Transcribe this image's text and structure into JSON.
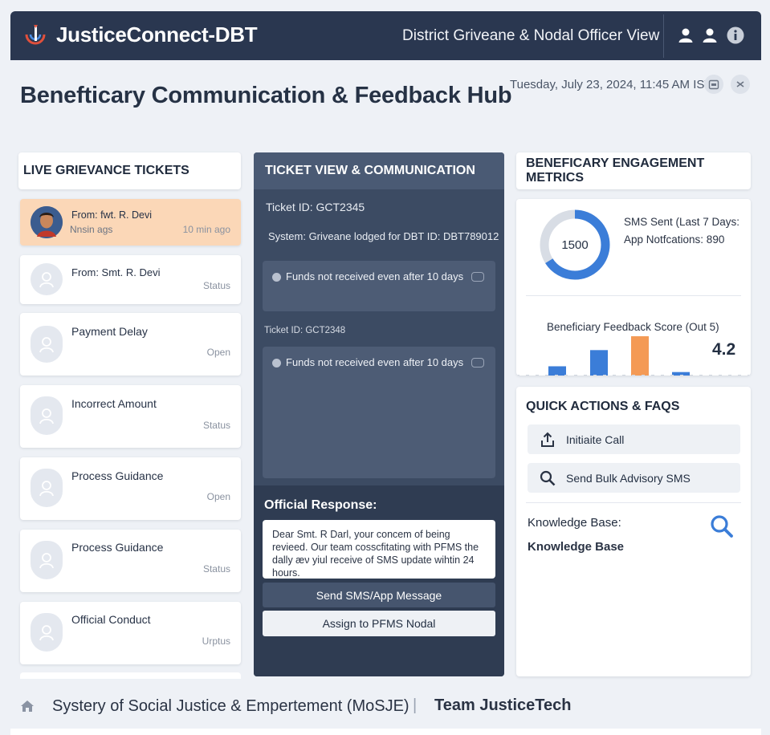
{
  "app": {
    "title": "JusticeConnect-DBT",
    "view": "District Griveane & Nodal Officer View"
  },
  "header": {
    "page_title": "Benefticary Communication & Feedback Hub",
    "datetime": "Tuesday, July 23, 2024, 11:45 AM IST"
  },
  "grievances": {
    "title": "LIVE GRIEVANCE TICKETS",
    "tickets": [
      {
        "title": "From: fwt. R. Devi",
        "sub": "Nnsin ags",
        "status": "10 min ago",
        "active": true
      },
      {
        "title": "From: Smt. R. Devi",
        "status": "Status"
      },
      {
        "title": "Payment Delay",
        "status": "Open"
      },
      {
        "title": "Incorrect Amount",
        "status": "Status"
      },
      {
        "title": "Process Guidance",
        "status": "Open"
      },
      {
        "title": "Process Guidance",
        "status": "Status"
      },
      {
        "title": "Official Conduct",
        "status": "Urptus"
      }
    ]
  },
  "ticket_view": {
    "title": "TICKET VIEW & COMMUNICATION",
    "ticket_id": "Ticket ID: GCT2345",
    "system_msg": "System: Griveane lodged for DBT ID: DBT789012",
    "message_1": "Funds not received even after 10 days",
    "ticket_id_2": "Ticket ID: GCT2348",
    "message_2": "Funds not received even after 10 days",
    "official_label": "Official Response:",
    "response_text": "Dear Smt. R Darl, your concem of being revieed. Our team cosscfitating with PFMS the dally æν yiul receive of SMS update wihtin 24 hours.",
    "send_button": "Send SMS/App Message",
    "assign_button": "Assign to PFMS Nodal"
  },
  "metrics": {
    "title": "BENEFICARY ENGAGEMENT METRICS",
    "donut_value": "1500",
    "donut_fraction": 0.66,
    "sms_sent": "SMS Sent (Last 7 Days:",
    "app_notifications": "App Notfcations: 890",
    "feedback_label": "Beneficiary Feedback Score (Out 5)",
    "feedback_score": "4.2",
    "colors": {
      "primary": "#3b7dd8",
      "accent": "#f49a55",
      "track": "#d8dde5"
    }
  },
  "chart_data": {
    "type": "bar",
    "title": "Beneficiary Feedback Score (Out 5)",
    "categories": [
      "",
      "",
      "",
      ""
    ],
    "values": [
      0.8,
      2.2,
      3.4,
      0.3
    ],
    "colors": [
      "#3b7dd8",
      "#3b7dd8",
      "#f49a55",
      "#3b7dd8"
    ],
    "ylim": [
      0,
      5
    ]
  },
  "quick_actions": {
    "title": "QUICK ACTIONS & FAQS",
    "initiate_call": "Initiaite Call",
    "bulk_sms": "Send Bulk Advisory SMS",
    "kb_label": "Knowledge Base:",
    "kb_value": "Knowledge Base"
  },
  "footer": {
    "org": "Systery of Social Justice & Empertement (MoSJE)",
    "separator": "|",
    "team": "Team JusticeTech"
  }
}
